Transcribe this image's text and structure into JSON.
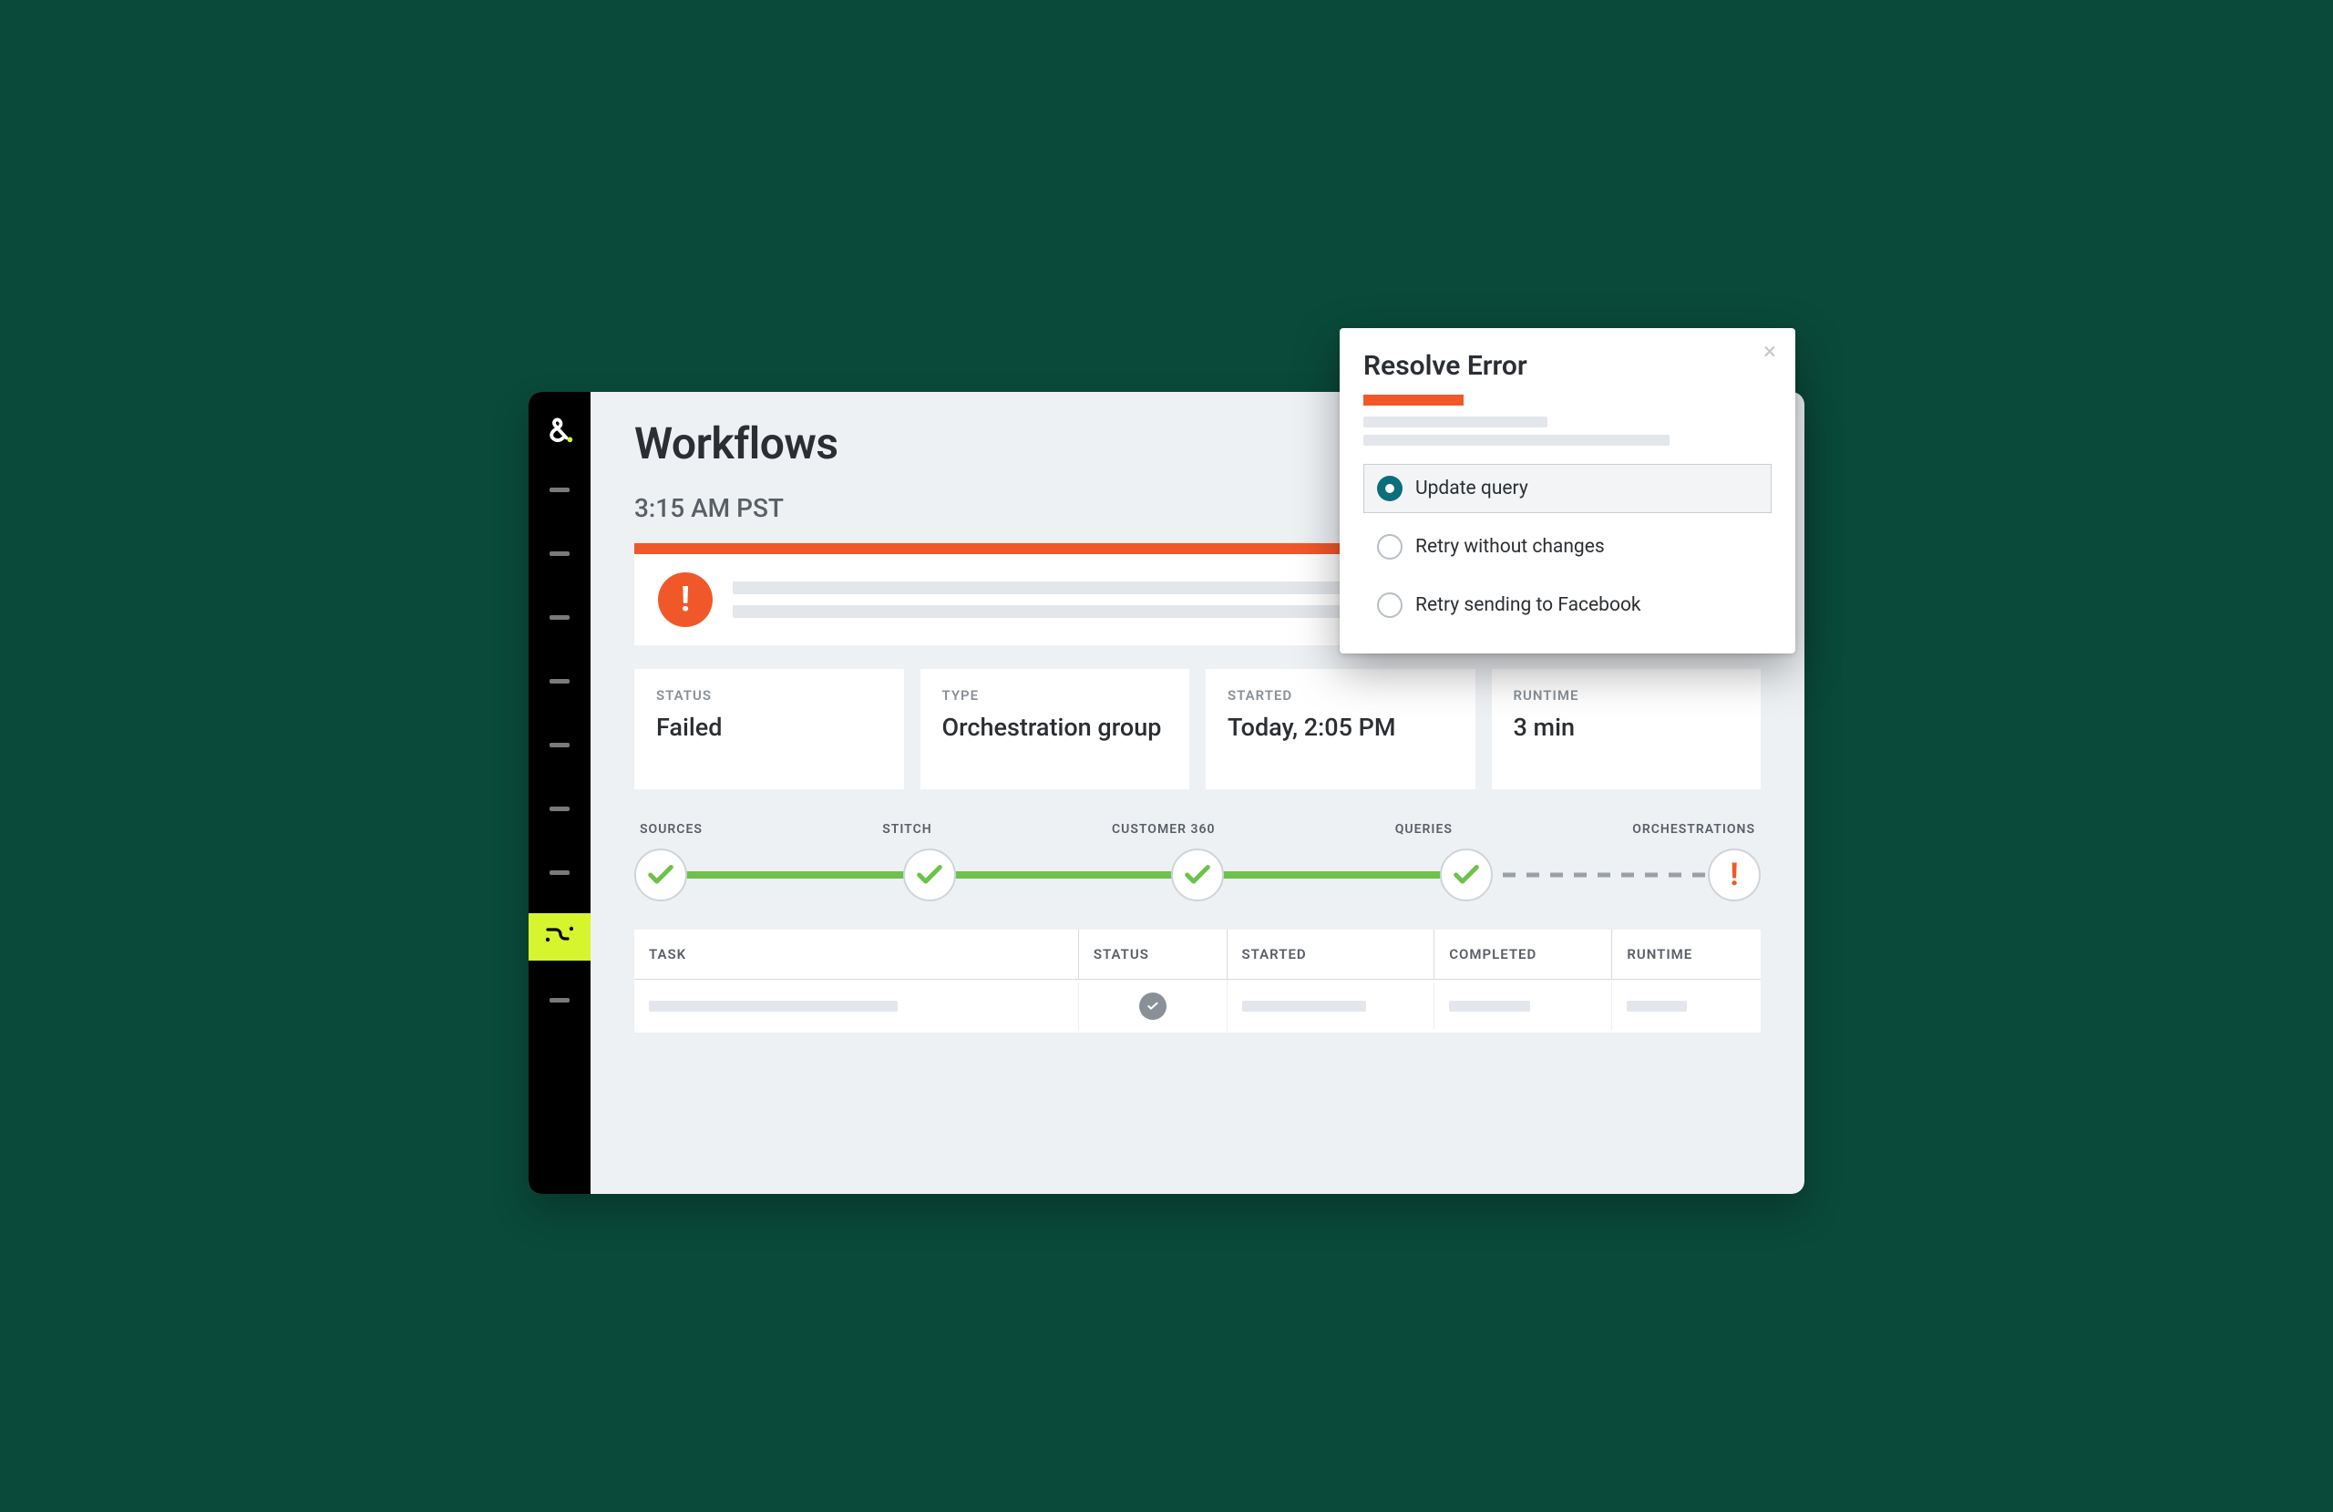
{
  "page": {
    "title": "Workflows",
    "subtitle": "3:15 AM PST"
  },
  "summary": {
    "status": {
      "label": "STATUS",
      "value": "Failed"
    },
    "type": {
      "label": "TYPE",
      "value": "Orchestration group"
    },
    "started": {
      "label": "STARTED",
      "value": "Today, 2:05 PM"
    },
    "runtime": {
      "label": "RUNTIME",
      "value": "3 min"
    }
  },
  "steps": {
    "sources": {
      "label": "SOURCES",
      "state": "done"
    },
    "stitch": {
      "label": "STITCH",
      "state": "done"
    },
    "customer360": {
      "label": "CUSTOMER 360",
      "state": "done"
    },
    "queries": {
      "label": "QUERIES",
      "state": "done"
    },
    "orchestrations": {
      "label": "ORCHESTRATIONS",
      "state": "error"
    }
  },
  "table": {
    "headers": {
      "task": "TASK",
      "status": "STATUS",
      "started": "STARTED",
      "completed": "COMPLETED",
      "runtime": "RUNTIME"
    }
  },
  "popover": {
    "title": "Resolve Error",
    "options": {
      "update": "Update query",
      "retry": "Retry without changes",
      "fb": "Retry sending to Facebook"
    },
    "selected": "update"
  }
}
